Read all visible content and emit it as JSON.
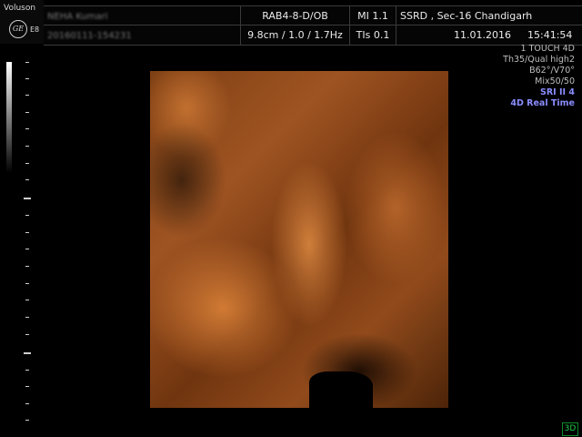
{
  "brand": {
    "name": "Voluson",
    "logo_text": "GE",
    "model": "E8"
  },
  "header": {
    "patient_name": "NEHA Kumari",
    "patient_id": "20160111-154231",
    "probe_preset": "RAB4-8-D/OB",
    "mi": "MI  1.1",
    "institution": "SSRD , Sec-16 Chandigarh",
    "depth_freq": "9.8cm / 1.0 / 1.7Hz",
    "tis": "TIs  0.1",
    "date": "11.01.2016",
    "time": "15:41:54"
  },
  "info_panel": [
    {
      "text": "1 TOUCH 4D",
      "color": "#bdbdbd"
    },
    {
      "text": "Th35/Qual high2",
      "color": "#bdbdbd"
    },
    {
      "text": "B62°/V70°",
      "color": "#bdbdbd"
    },
    {
      "text": "Mix50/50",
      "color": "#bdbdbd"
    },
    {
      "text": "SRI II 4",
      "color": "#8a8cff"
    },
    {
      "text": "4D Real Time",
      "color": "#8a8cff"
    }
  ],
  "render_view": {
    "description_icon": "3d-render-icon"
  },
  "mode_indicator": "3D",
  "colors": {
    "background": "#000000",
    "render_tint": "#8e4b1e",
    "status_blue": "#8a8cff",
    "mode_green": "#1fd04a"
  }
}
